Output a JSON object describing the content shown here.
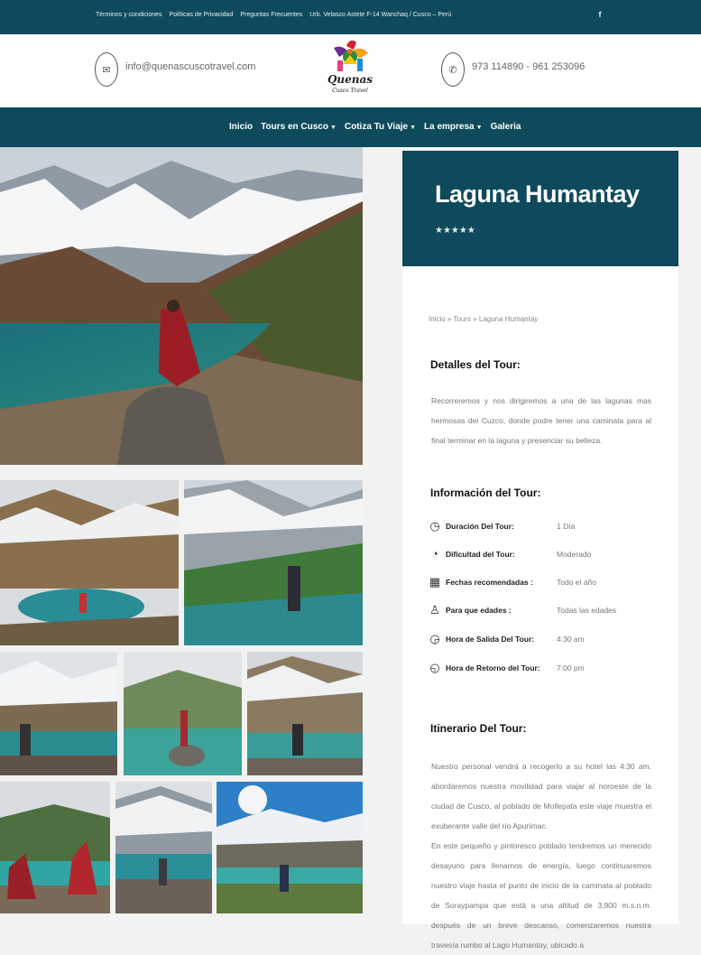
{
  "topbar": {
    "links": [
      "Términos y condiciones",
      "Políticas de Privacidad",
      "Preguntas Frecuentes",
      "Urb. Velasco Astete F-14 Wanchaq / Cusco – Perú"
    ],
    "social_icon": "facebook-icon"
  },
  "header": {
    "email": "info@quenascuscotravel.com",
    "phone": "973 114890 - 961 253096",
    "logo_name": "Quenas",
    "logo_sub": "Cusco Travel"
  },
  "nav": {
    "items": [
      {
        "label": "Inicio",
        "dropdown": false
      },
      {
        "label": "Tours en Cusco",
        "dropdown": true
      },
      {
        "label": "Cotiza Tu Viaje",
        "dropdown": true
      },
      {
        "label": "La empresa",
        "dropdown": true
      },
      {
        "label": "Galeria",
        "dropdown": false
      }
    ]
  },
  "tour": {
    "title": "Laguna Humantay",
    "rating": 5,
    "stars_text": "★★★★★",
    "breadcrumb": "Inicio » Tours » Laguna Humantay",
    "details_heading": "Detalles del Tour:",
    "details_text": "Recorreremos y nos dirigiremos a una de las lagunas mas hermosas del Cuzco, donde podre tener una caminata para al final terminar en la laguna y presenciar su belleza.",
    "info_heading": "Información del Tour:",
    "info": [
      {
        "label": "Duración Del Tour:",
        "value": "1 Día",
        "icon": "clock-icon"
      },
      {
        "label": "Dificultad del Tour:",
        "value": "Moderado",
        "icon": "gauge-icon"
      },
      {
        "label": "Fechas recomendadas :",
        "value": "Todo el año",
        "icon": "calendar-icon"
      },
      {
        "label": "Para que edades :",
        "value": "Todas las edades",
        "icon": "family-icon"
      },
      {
        "label": "Hora de Salida Del Tour:",
        "value": "4:30 am",
        "icon": "clock-arrow-icon"
      },
      {
        "label": "Hora de Retorno del Tour:",
        "value": "7:00 pm",
        "icon": "clock-return-icon"
      }
    ],
    "itinerary_heading": "Itinerario Del Tour:",
    "itinerary_p1": "Nuestro personal vendrá a recogerlo a su hotel las 4:30 am, abordaremos nuestra movilidad para viajar al noroeste de la ciudad de Cusco, al poblado de Mollepata este viaje muestra el exuberante valle del río Apurímac.",
    "itinerary_p2": "En este pequeño y pintoresco poblado tendremos un merecido desayuno para llenarnos de energía, luego continuaremos nuestro viaje hasta el punto de inicio de la caminata al poblado de Soraypampa que está a una altitud de 3,900 m.s.n.m. después de un breve descanso, comenzaremos nuestra travesía rumbo al Lago Humantay, ubicado a"
  },
  "colors": {
    "brand": "#0e4a5b",
    "text_muted": "#777777"
  }
}
